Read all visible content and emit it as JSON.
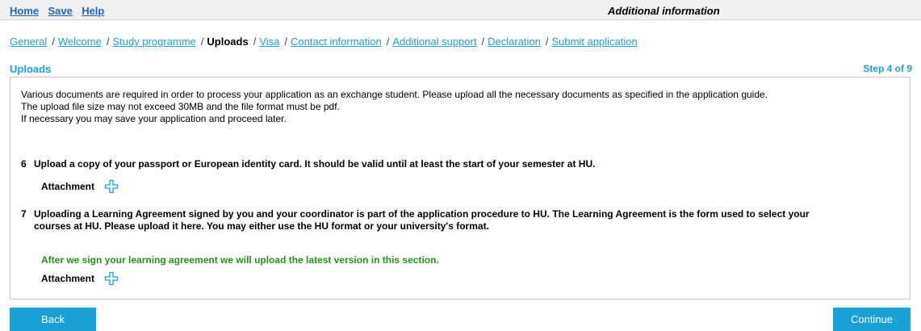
{
  "topbar": {
    "links": [
      "Home",
      "Save",
      "Help"
    ],
    "title": "Additional information"
  },
  "breadcrumb": [
    {
      "label": "General",
      "current": false
    },
    {
      "label": "Welcome",
      "current": false
    },
    {
      "label": "Study programme",
      "current": false
    },
    {
      "label": "Uploads",
      "current": true
    },
    {
      "label": "Visa",
      "current": false
    },
    {
      "label": "Contact information",
      "current": false
    },
    {
      "label": "Additional support",
      "current": false
    },
    {
      "label": "Declaration",
      "current": false
    },
    {
      "label": "Submit application",
      "current": false
    }
  ],
  "breadcrumb_separator": "/",
  "section": {
    "title": "Uploads",
    "step": "Step 4 of 9"
  },
  "intro": {
    "line1": "Various documents are required in order to process your application as an exchange student. Please upload all the necessary documents as specified in the application guide.",
    "line2": "The upload file size may not exceed 30MB and the file format must be pdf.",
    "line3": "If necessary you may save your application and proceed later."
  },
  "questions": [
    {
      "number": "6",
      "text": "Upload a copy of your passport or European identity card. It should be valid until at least the start of your semester at HU.",
      "attachment_label": "Attachment"
    },
    {
      "number": "7",
      "text": "Uploading a Learning Agreement signed by you and your coordinator is part of the application procedure to HU. The Learning Agreement is the form used to select your courses at HU. Please upload it here. You may either use the HU format or your university's format.",
      "note": "After we sign your learning agreement we will upload the latest version in this section.",
      "attachment_label": "Attachment"
    }
  ],
  "buttons": {
    "back": "Back",
    "continue": "Continue"
  },
  "icons": {
    "attachment_add": "plus-icon"
  },
  "colors": {
    "accent": "#1aa2d6",
    "link": "#1f66c1",
    "note": "#2a8f1e"
  }
}
